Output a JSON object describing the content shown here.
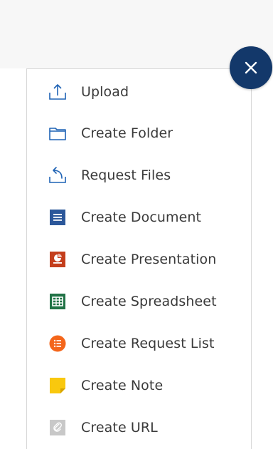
{
  "menu": {
    "items": [
      {
        "label": "Upload",
        "icon": "upload-icon"
      },
      {
        "label": "Create Folder",
        "icon": "folder-icon"
      },
      {
        "label": "Request Files",
        "icon": "request-files-icon"
      },
      {
        "label": "Create Document",
        "icon": "document-icon"
      },
      {
        "label": "Create Presentation",
        "icon": "presentation-icon"
      },
      {
        "label": "Create Spreadsheet",
        "icon": "spreadsheet-icon"
      },
      {
        "label": "Create Request List",
        "icon": "request-list-icon"
      },
      {
        "label": "Create Note",
        "icon": "note-icon"
      },
      {
        "label": "Create URL",
        "icon": "url-icon"
      }
    ]
  },
  "close_button": {
    "icon": "close-icon"
  },
  "colors": {
    "accent_blue": "#1f63b5",
    "close_button": "#13386a",
    "document": "#2b579a",
    "presentation": "#c43e1c",
    "spreadsheet": "#217346",
    "request_list": "#f4661b",
    "note": "#f9c80e",
    "url": "#c8c8c8",
    "label_text": "#3a3a3a"
  }
}
